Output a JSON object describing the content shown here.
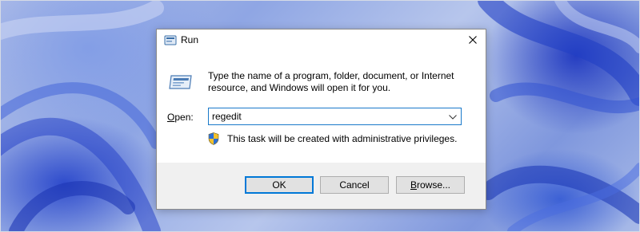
{
  "dialog": {
    "title": "Run",
    "description": "Type the name of a program, folder, document, or Internet resource, and Windows will open it for you.",
    "open_label_accel": "O",
    "open_label_rest": "pen:",
    "input_value": "regedit",
    "admin_note": "This task will be created with administrative privileges."
  },
  "buttons": {
    "ok": "OK",
    "cancel": "Cancel",
    "browse_accel": "B",
    "browse_rest": "rowse..."
  },
  "icons": {
    "title": "run-icon",
    "main": "run-icon",
    "close": "close-icon",
    "dropdown": "chevron-down-icon",
    "shield": "uac-shield-icon"
  },
  "colors": {
    "accent": "#0078d7",
    "footer": "#f0f0f0",
    "desktop": "#8fa6e4"
  }
}
